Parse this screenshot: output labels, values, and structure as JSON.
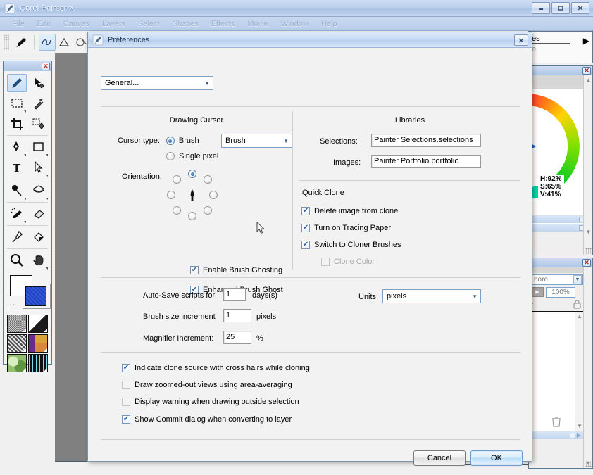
{
  "app": {
    "title": "Corel Painter X",
    "icon": "brush-icon",
    "window_buttons": [
      {
        "name": "minimize",
        "glyph": "–"
      },
      {
        "name": "maximize",
        "glyph": "□"
      },
      {
        "name": "close",
        "glyph": "✕"
      }
    ],
    "menus": [
      "File",
      "Edit",
      "Canvas",
      "Layers",
      "Select",
      "Shapes",
      "Effects",
      "Movie",
      "Window",
      "Help"
    ]
  },
  "tool_palette": {
    "close_glyph": "✕",
    "tools": [
      {
        "name": "brush-tool",
        "selected": true
      },
      {
        "name": "layer-adjuster-tool",
        "selected": false
      },
      {
        "name": "rectangular-selection-tool",
        "selected": false
      },
      {
        "name": "magic-wand-tool",
        "selected": false
      },
      {
        "name": "crop-tool",
        "selected": false
      },
      {
        "name": "selection-adjuster-tool",
        "selected": false
      },
      {
        "name": "pen-tool",
        "selected": false
      },
      {
        "name": "rectangular-shape-tool",
        "selected": false
      },
      {
        "name": "text-tool",
        "selected": false
      },
      {
        "name": "shape-selection-tool",
        "selected": false
      },
      {
        "name": "dropper-tool",
        "selected": false
      },
      {
        "name": "paint-bucket-tool",
        "selected": false
      },
      {
        "name": "eraser-tool",
        "selected": false
      },
      {
        "name": "color-picker-tool",
        "selected": false
      },
      {
        "name": "magnifier-tool",
        "selected": false
      },
      {
        "name": "grabber-tool",
        "selected": false
      }
    ],
    "color_selector": {
      "main_color": "#ffffff",
      "additional_color": "#1b42c8",
      "swap_glyph": "↔"
    },
    "media_swatches": [
      {
        "name": "paper-selector"
      },
      {
        "name": "gradient-selector"
      },
      {
        "name": "pattern-selector"
      },
      {
        "name": "weave-selector"
      },
      {
        "name": "nozzle-selector"
      },
      {
        "name": "look-selector"
      }
    ]
  },
  "right_panels": {
    "top_fragment": {
      "line1": "es",
      "line2": "e",
      "arrow": "▶"
    },
    "colors_panel": {
      "close_glyph": "✕",
      "hsv": {
        "h": "H:92%",
        "s": "S:65%",
        "v": "V:41%"
      }
    },
    "layers_panel": {
      "close_glyph": "✕",
      "composite_method": "nore",
      "opacity": "100%",
      "lock_icon": "lock-icon",
      "trash_icon": "trash-icon"
    }
  },
  "prefs": {
    "title": "Preferences",
    "icon": "brush-icon",
    "close_glyph": "✕",
    "category": {
      "value": "General...",
      "caret": "▼"
    },
    "drawing_cursor": {
      "heading": "Drawing Cursor",
      "cursor_type_label": "Cursor type:",
      "options": [
        {
          "label": "Brush",
          "selected": true
        },
        {
          "label": "Single pixel",
          "selected": false
        }
      ],
      "brush_combo": {
        "value": "Brush",
        "caret": "▼"
      },
      "orientation_label": "Orientation:",
      "orientation_selected_index": 0,
      "orientation_count": 8,
      "checkboxes": [
        {
          "label": "Enable Brush Ghosting",
          "checked": true
        },
        {
          "label": "Enhanced Brush Ghost",
          "checked": true
        }
      ]
    },
    "libraries": {
      "heading": "Libraries",
      "fields": [
        {
          "label": "Selections:",
          "value": "Painter Selections.selections"
        },
        {
          "label": "Images:",
          "value": "Painter Portfolio.portfolio"
        }
      ]
    },
    "quick_clone": {
      "heading": "Quick Clone",
      "checkboxes": [
        {
          "label": "Delete image from clone",
          "checked": true,
          "disabled": false
        },
        {
          "label": "Turn on Tracing Paper",
          "checked": true,
          "disabled": false
        },
        {
          "label": "Switch to Cloner Brushes",
          "checked": true,
          "disabled": false
        },
        {
          "label": "Clone Color",
          "checked": false,
          "disabled": true
        }
      ]
    },
    "numeric": [
      {
        "label": "Auto-Save scripts for",
        "value": "1",
        "suffix": "days(s)"
      },
      {
        "label": "Brush size increment",
        "value": "1",
        "suffix": "pixels"
      },
      {
        "label": "Magnifier Increment:",
        "value": "25",
        "suffix": "%"
      }
    ],
    "units": {
      "label": "Units:",
      "value": "pixels",
      "caret": "▼"
    },
    "bottom_checkboxes": [
      {
        "label": "Indicate clone source with cross hairs while cloning",
        "checked": true
      },
      {
        "label": "Draw zoomed-out views using area-averaging",
        "checked": false
      },
      {
        "label": "Display warning when drawing outside selection",
        "checked": false
      },
      {
        "label": "Show Commit dialog when converting to layer",
        "checked": true
      }
    ],
    "buttons": {
      "cancel": "Cancel",
      "ok": "OK"
    }
  },
  "colors": {
    "titlebar_blue": "#bdd0ec",
    "dialog_bg": "#f2f2f2",
    "canvas_grey": "#808080",
    "accent_blue": "#1f5fd0",
    "ok_button_blue": "#b9dcf6"
  }
}
